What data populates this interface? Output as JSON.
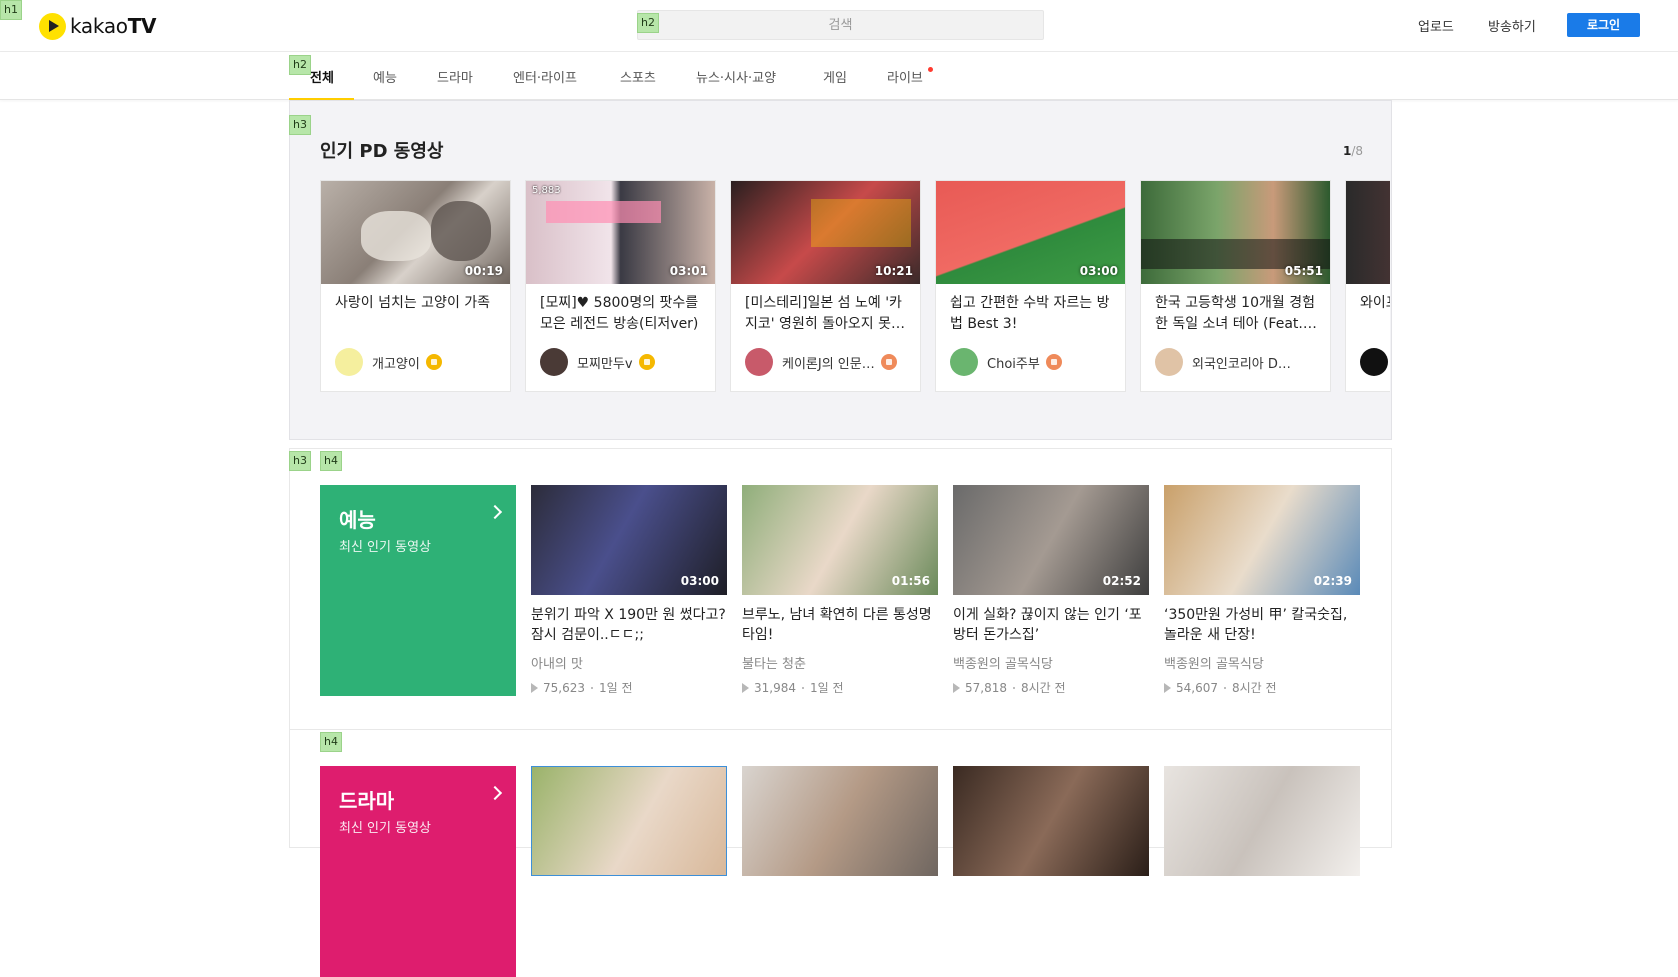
{
  "outline_tags": [
    "h1",
    "h2",
    "h2",
    "h3",
    "h3",
    "h4",
    "h4"
  ],
  "header": {
    "logo_text_light": "kakao",
    "logo_text_bold": "TV",
    "search_placeholder": "검색",
    "upload": "업로드",
    "broadcast": "방송하기",
    "login": "로그인"
  },
  "nav": {
    "items": [
      "전체",
      "예능",
      "드라마",
      "엔터·라이프",
      "스포츠",
      "뉴스·시사·교양",
      "게임",
      "라이브"
    ],
    "active_index": 0
  },
  "popular_pd": {
    "title": "인기 PD 동영상",
    "page_current": "1",
    "page_total": "/8",
    "cards": [
      {
        "title": "사랑이 넘치는 고양이 가족",
        "duration": "00:19",
        "channel": "개고양이",
        "badge": "s"
      },
      {
        "title": "[모찌]♥ 5800명의 팟수를 모은 레전드 방송(티저ver)",
        "duration": "03:01",
        "channel": "모찌만두v",
        "badge": "s",
        "views": "5,883"
      },
      {
        "title": "[미스테리]일본 섬 노예 '카지코' 영원히 돌아오지 못…",
        "duration": "10:21",
        "channel": "케이론J의 인문…",
        "badge": "b"
      },
      {
        "title": "쉽고 간편한 수박 자르는 방법 Best 3!",
        "duration": "03:00",
        "channel": "Choi주부",
        "badge": "b"
      },
      {
        "title": "한국 고등학생 10개월 경험한 독일 소녀 테아 (Feat.…",
        "duration": "05:51",
        "channel": "외국인코리아 D…",
        "badge": ""
      },
      {
        "title": "와이프 세계일…",
        "duration": "",
        "channel": "",
        "badge": ""
      }
    ]
  },
  "sections": [
    {
      "title": "예능",
      "subtitle": "최신 인기 동영상",
      "color": "#2eb176",
      "videos": [
        {
          "title": "분위기 파악 X 190만 원 썼다고? 잠시 검문이..ㄷㄷ;;",
          "duration": "03:00",
          "channel": "아내의 맛",
          "views": "75,623",
          "age": "1일 전"
        },
        {
          "title": "브루노, 남녀 확연히 다른 통성명 타임!",
          "duration": "01:56",
          "channel": "불타는 청춘",
          "views": "31,984",
          "age": "1일 전"
        },
        {
          "title": "이게 실화? 끊이지 않는 인기 ‘포방터 돈가스집’",
          "duration": "02:52",
          "channel": "백종원의 골목식당",
          "views": "57,818",
          "age": "8시간 전"
        },
        {
          "title": "‘350만원 가성비 甲’ 칼국숫집, 놀라운 새 단장!",
          "duration": "02:39",
          "channel": "백종원의 골목식당",
          "views": "54,607",
          "age": "8시간 전"
        }
      ]
    },
    {
      "title": "드라마",
      "subtitle": "최신 인기 동영상",
      "color": "#de1d6e"
    }
  ]
}
